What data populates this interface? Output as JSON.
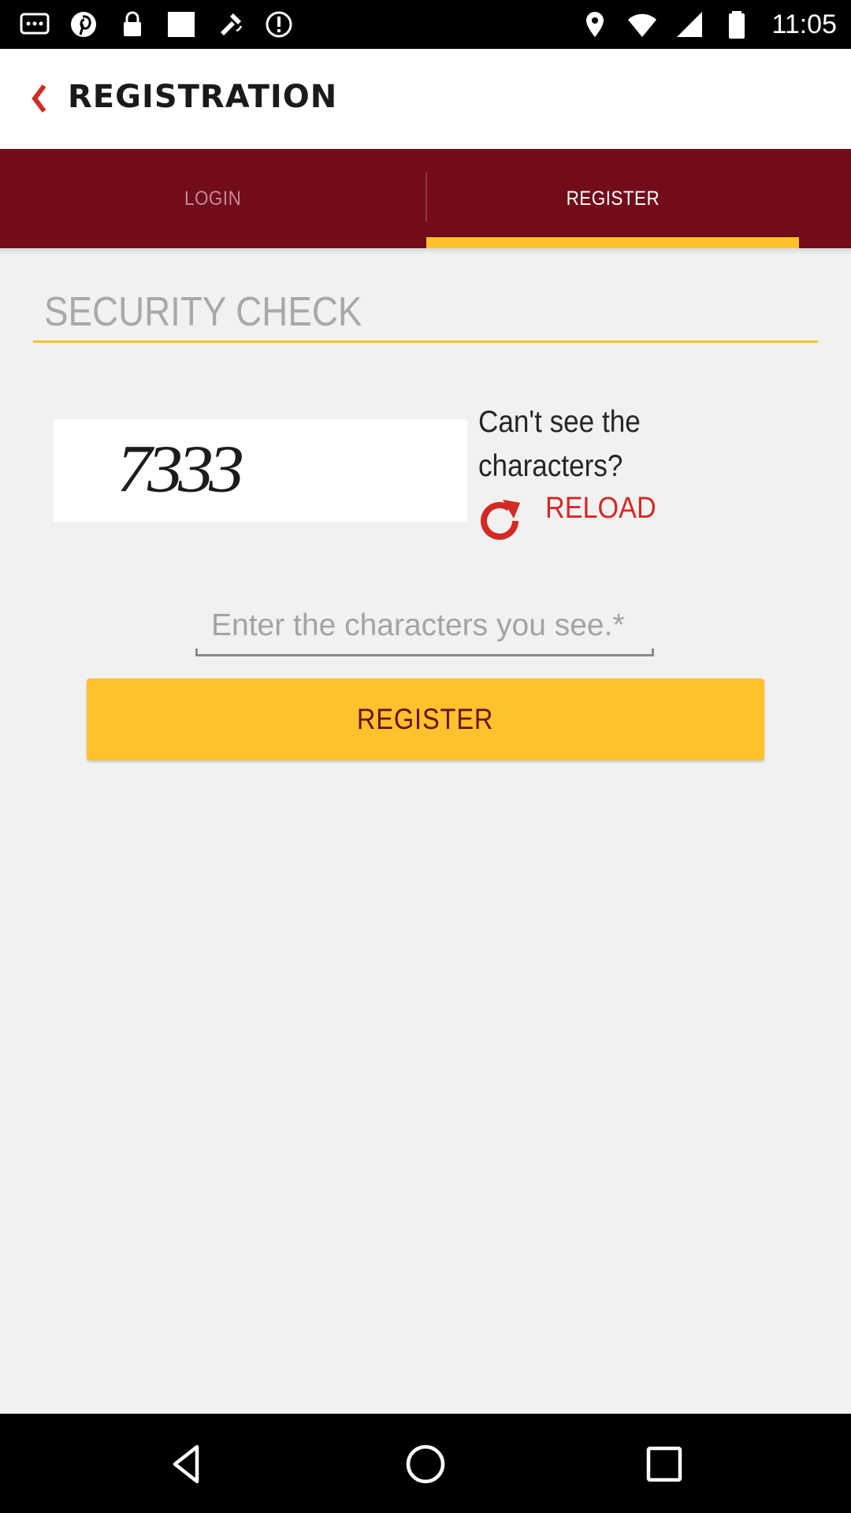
{
  "status_bar": {
    "time": "11:05",
    "left_icons": [
      "chat-dots-icon",
      "pinterest-icon",
      "lock-icon",
      "blank-image-icon",
      "fake-gps-icon",
      "info-icon"
    ],
    "right_icons": [
      "location-icon",
      "wifi-icon",
      "signal-icon",
      "battery-icon"
    ]
  },
  "app_bar": {
    "title": "REGISTRATION",
    "back_icon": "chevron-left-icon",
    "accent_color": "#d22a24"
  },
  "tabs": {
    "items": [
      {
        "label": "LOGIN",
        "selected": false
      },
      {
        "label": "REGISTER",
        "selected": true
      }
    ],
    "background_color": "#720c1a",
    "indicator_color": "#fdc22c"
  },
  "security": {
    "title": "SECURITY CHECK",
    "captcha_text": "7333",
    "cant_see_text": "Can't see the characters?",
    "reload_label": "RELOAD",
    "reload_icon": "refresh-icon",
    "input_placeholder": "Enter the characters you see.*",
    "input_value": ""
  },
  "register_button": {
    "label": "REGISTER",
    "color": "#fdc22c"
  },
  "nav_bar": {
    "icons": [
      "nav-back-icon",
      "nav-home-icon",
      "nav-recents-icon"
    ]
  }
}
